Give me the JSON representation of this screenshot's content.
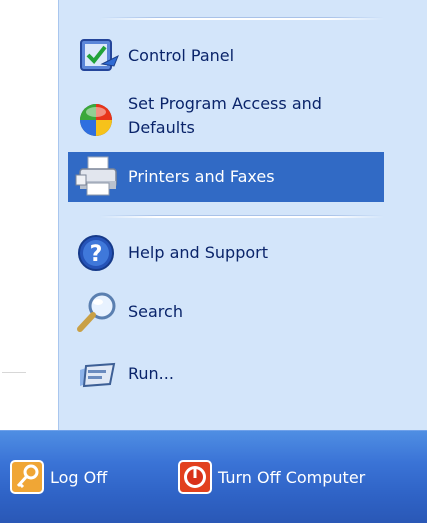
{
  "menu": {
    "items": [
      {
        "label": "Control Panel",
        "icon": "control-panel-icon"
      },
      {
        "label_lines": [
          "Set Program Access and",
          "Defaults"
        ],
        "icon": "program-access-icon"
      },
      {
        "label": "Printers and Faxes",
        "icon": "printer-icon",
        "selected": true
      },
      {
        "label": "Help and Support",
        "icon": "help-icon"
      },
      {
        "label": "Search",
        "icon": "search-icon"
      },
      {
        "label": "Run...",
        "icon": "run-icon"
      }
    ]
  },
  "bottom_bar": {
    "log_off_label": "Log Off",
    "turn_off_label": "Turn Off Computer"
  },
  "colors": {
    "pane_bg": "#d3e5fa",
    "selection": "#316ac5",
    "bottom_bar": "#2f63c6",
    "text": "#0a246a"
  }
}
